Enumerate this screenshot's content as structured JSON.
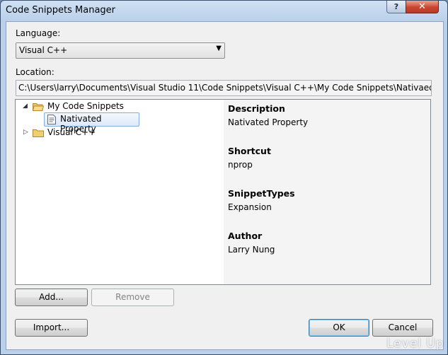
{
  "window": {
    "title": "Code Snippets Manager",
    "help_glyph": "?",
    "close_glyph": "✕"
  },
  "language": {
    "label": "Language:",
    "selected": "Visual C++"
  },
  "location": {
    "label": "Location:",
    "path": "C:\\Users\\larry\\Documents\\Visual Studio 11\\Code Snippets\\Visual C++\\My Code Snippets\\NativaedPro"
  },
  "tree": {
    "items": [
      {
        "label": "My Code Snippets",
        "expanded": true,
        "icon": "folder-open-icon"
      },
      {
        "label": "Nativated Property",
        "icon": "snippet-file-icon",
        "selected": true
      },
      {
        "label": "Visual C++",
        "expanded": false,
        "icon": "folder-icon"
      }
    ]
  },
  "details": {
    "description_label": "Description",
    "description_value": "Nativated Property",
    "shortcut_label": "Shortcut",
    "shortcut_value": "nprop",
    "types_label": "SnippetTypes",
    "types_value": "Expansion",
    "author_label": "Author",
    "author_value": "Larry Nung"
  },
  "buttons": {
    "add": "Add...",
    "remove": "Remove",
    "import": "Import...",
    "ok": "OK",
    "cancel": "Cancel"
  },
  "watermark": "Level Up",
  "colors": {
    "title_gradient_top": "#cfe0f2",
    "selection_border": "#84acdd",
    "default_button_border": "#3c7fb1"
  }
}
